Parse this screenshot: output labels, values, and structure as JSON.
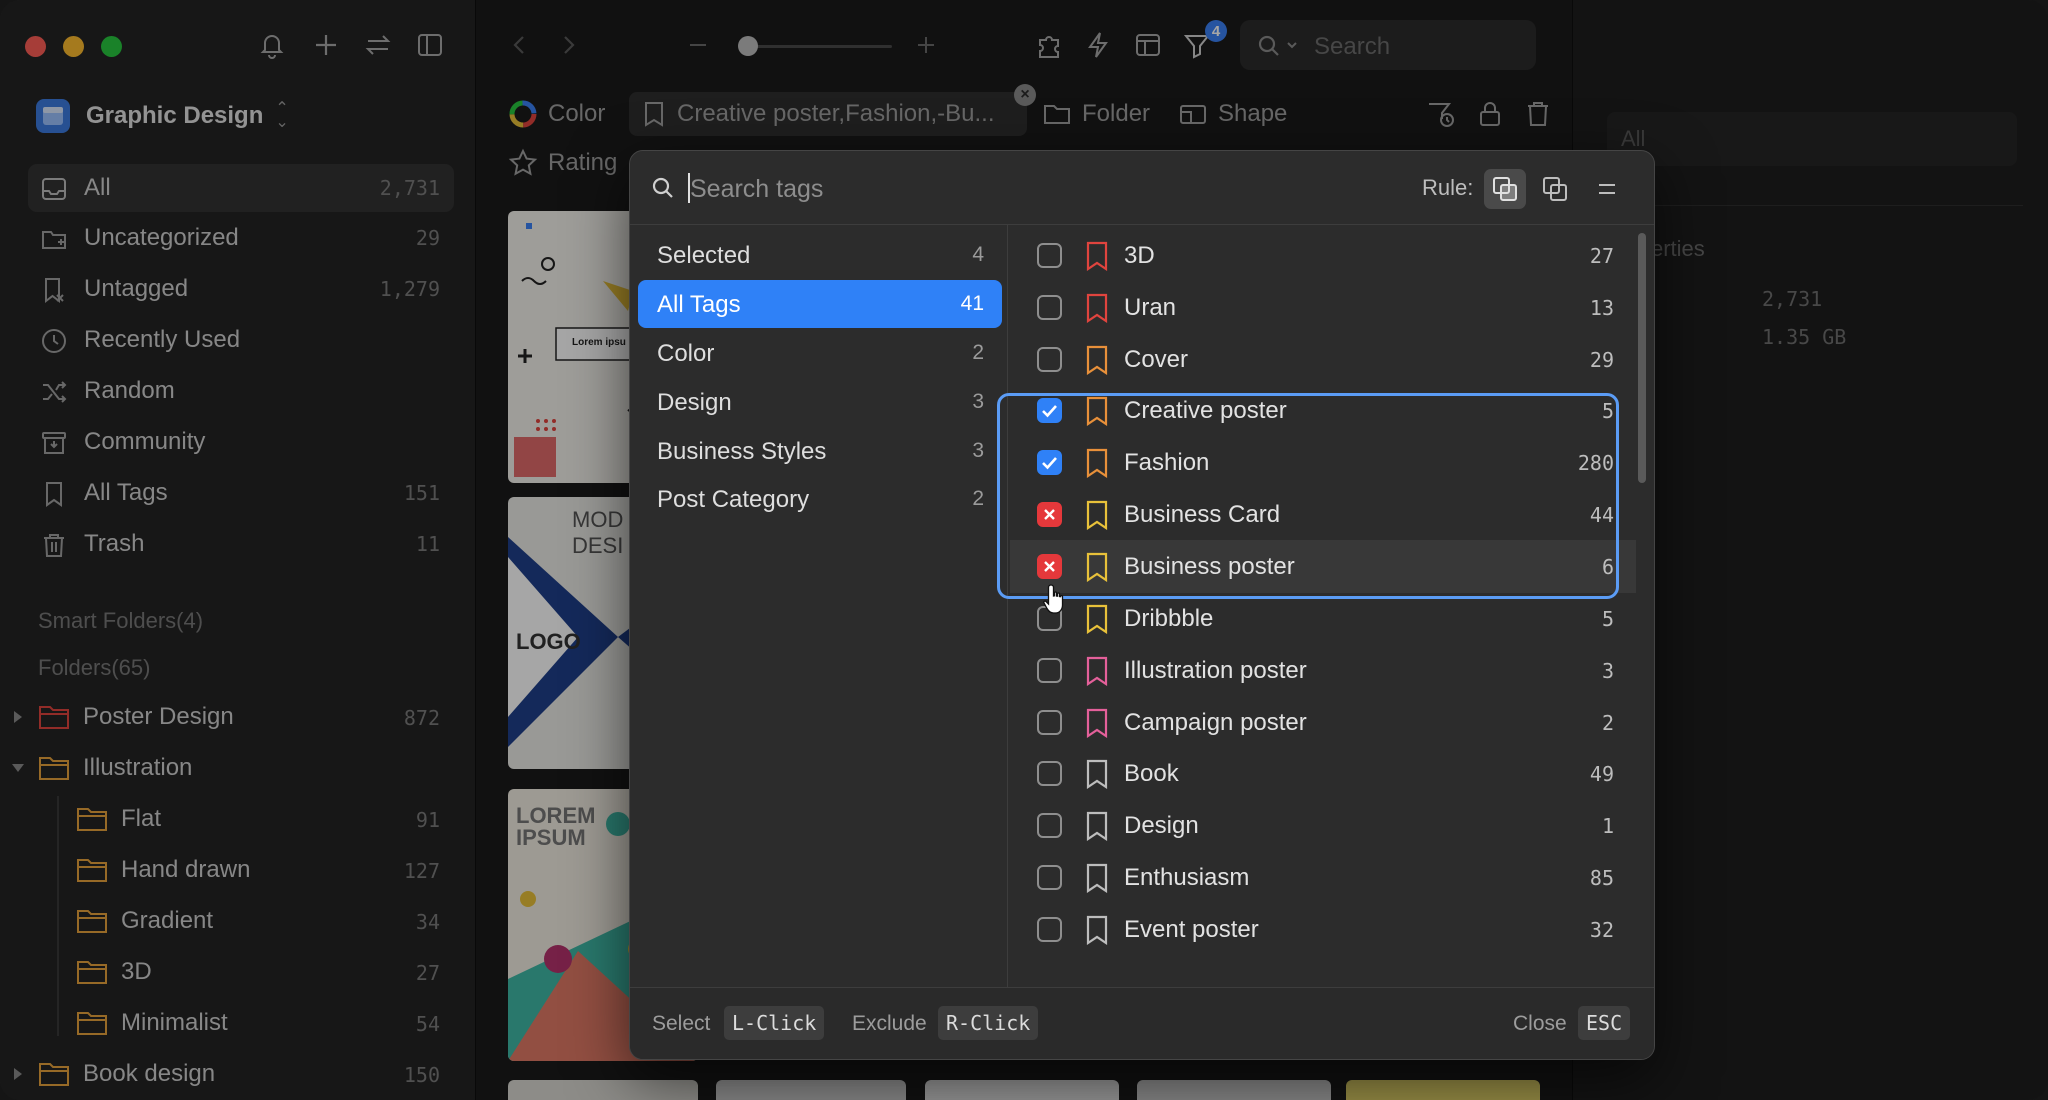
{
  "colors": {
    "accent": "#2f81f7",
    "exclude": "#e5383b",
    "folder": "#e8a33d",
    "red_folder": "#e0443e"
  },
  "library": {
    "name": "Graphic Design"
  },
  "nav": [
    {
      "label": "All",
      "count": "2,731",
      "icon": "inbox-icon"
    },
    {
      "label": "Uncategorized",
      "count": "29",
      "icon": "uncategorized-folder-icon"
    },
    {
      "label": "Untagged",
      "count": "1,279",
      "icon": "untagged-icon"
    },
    {
      "label": "Recently Used",
      "count": "",
      "icon": "clock-icon"
    },
    {
      "label": "Random",
      "count": "",
      "icon": "shuffle-icon"
    },
    {
      "label": "Community",
      "count": "",
      "icon": "community-icon"
    },
    {
      "label": "All Tags",
      "count": "151",
      "icon": "bookmark-icon"
    },
    {
      "label": "Trash",
      "count": "11",
      "icon": "trash-icon"
    }
  ],
  "sections": {
    "smart_folders": "Smart Folders(4)",
    "folders": "Folders(65)"
  },
  "folders": [
    {
      "label": "Poster Design",
      "count": "872"
    },
    {
      "label": "Illustration",
      "count": ""
    },
    {
      "label": "Flat",
      "count": "91"
    },
    {
      "label": "Hand drawn",
      "count": "127"
    },
    {
      "label": "Gradient",
      "count": "34"
    },
    {
      "label": "3D",
      "count": "27"
    },
    {
      "label": "Minimalist",
      "count": "54"
    },
    {
      "label": "Book design",
      "count": "150"
    }
  ],
  "toolbar": {
    "search_placeholder": "Search",
    "filter_badge": "4"
  },
  "filters": {
    "color": "Color",
    "tags": "Creative poster,Fashion,-Bu...",
    "folder": "Folder",
    "shape": "Shape",
    "rating": "Rating"
  },
  "inspector": {
    "all_label": "All",
    "properties_label": "erties",
    "count": "2,731",
    "size": "1.35 GB"
  },
  "thumbs": {
    "t1_text": "Lorem ipsu",
    "t2_title": "MOD\nDESI",
    "t2_logo": "LOGO",
    "t3_title": "LOREM\nIPSUM"
  },
  "popover": {
    "search_placeholder": "Search tags",
    "rule_label": "Rule:",
    "categories": [
      {
        "label": "Selected",
        "count": "4"
      },
      {
        "label": "All Tags",
        "count": "41"
      },
      {
        "label": "Color",
        "count": "2"
      },
      {
        "label": "Design",
        "count": "3"
      },
      {
        "label": "Business Styles",
        "count": "3"
      },
      {
        "label": "Post Category",
        "count": "2"
      }
    ],
    "tags": [
      {
        "label": "3D",
        "count": "27",
        "state": "none",
        "color": "#e0443e"
      },
      {
        "label": "Uran",
        "count": "13",
        "state": "none",
        "color": "#e0443e"
      },
      {
        "label": "Cover",
        "count": "29",
        "state": "none",
        "color": "#e8903a"
      },
      {
        "label": "Creative poster",
        "count": "5",
        "state": "checked",
        "color": "#e8903a"
      },
      {
        "label": "Fashion",
        "count": "280",
        "state": "checked",
        "color": "#e8903a"
      },
      {
        "label": "Business Card",
        "count": "44",
        "state": "excluded",
        "color": "#e8c13a"
      },
      {
        "label": "Business poster",
        "count": "6",
        "state": "excluded",
        "color": "#e8c13a"
      },
      {
        "label": "Dribbble",
        "count": "5",
        "state": "none",
        "color": "#e8c13a"
      },
      {
        "label": "Illustration poster",
        "count": "3",
        "state": "none",
        "color": "#e4609a"
      },
      {
        "label": "Campaign poster",
        "count": "2",
        "state": "none",
        "color": "#e4609a"
      },
      {
        "label": "Book",
        "count": "49",
        "state": "none",
        "color": "#bdbdbd"
      },
      {
        "label": "Design",
        "count": "1",
        "state": "none",
        "color": "#bdbdbd"
      },
      {
        "label": "Enthusiasm",
        "count": "85",
        "state": "none",
        "color": "#bdbdbd"
      },
      {
        "label": "Event poster",
        "count": "32",
        "state": "none",
        "color": "#bdbdbd"
      }
    ],
    "footer": {
      "select_label": "Select",
      "select_key": "L-Click",
      "exclude_label": "Exclude",
      "exclude_key": "R-Click",
      "close_label": "Close",
      "close_key": "ESC"
    }
  }
}
